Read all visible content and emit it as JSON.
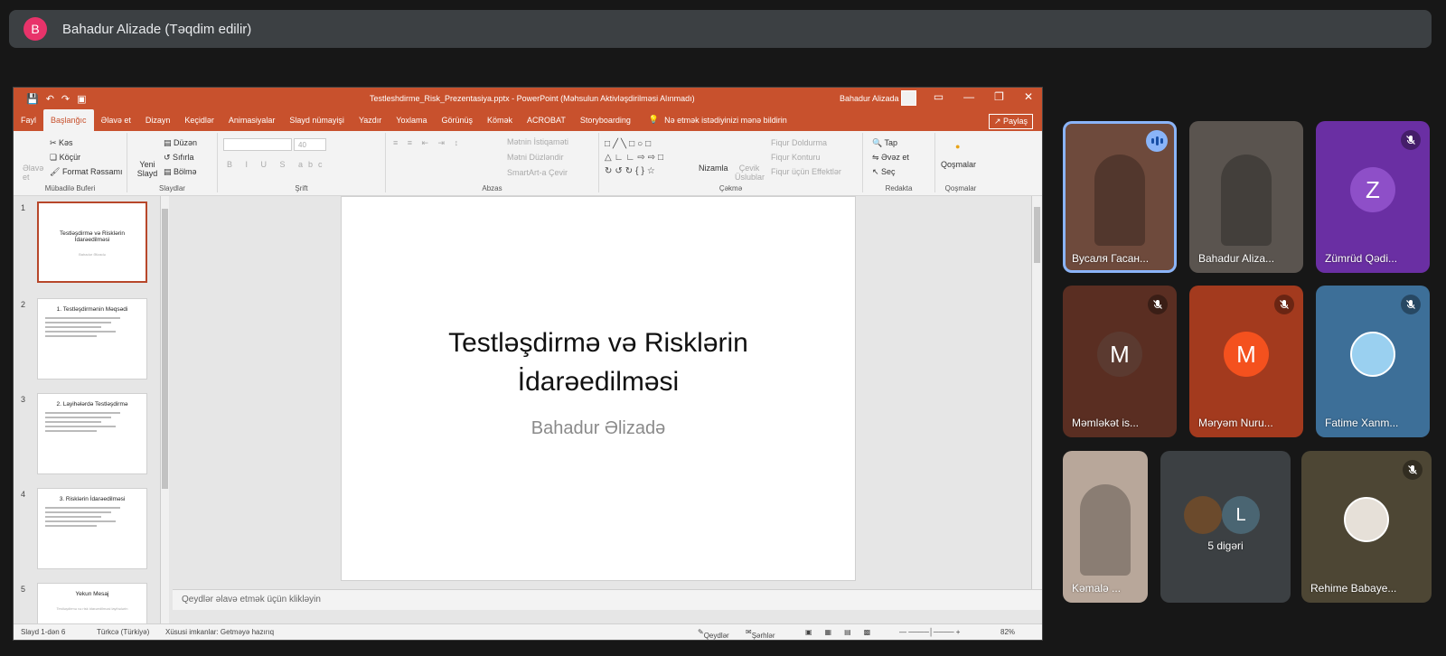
{
  "meet": {
    "presenter_initial": "B",
    "presenter_label": "Bahadur Alizade (Təqdim edilir)",
    "accent": "#e8336a"
  },
  "ppt": {
    "doc_title": "Testleshdirme_Risk_Prezentasiya.pptx  -  PowerPoint (Məhsulun Aktivləşdirilməsi Alınmadı)",
    "user": "Bahadur Alizada",
    "share": "Paylaş",
    "tabs": [
      "Fayl",
      "Başlanğıc",
      "Əlavə et",
      "Dizayn",
      "Keçidlər",
      "Animasiyalar",
      "Slayd nümayişi",
      "Yazdır",
      "Yoxlama",
      "Görünüş",
      "Kömək",
      "ACROBAT",
      "Storyboarding"
    ],
    "active_tab": "Başlanğıc",
    "tell_me": "Nə etmək istədiyinizi mənə bildirin",
    "ribbon": {
      "clipboard": {
        "paste": "Əlavə et",
        "cut": "Kəs",
        "copy": "Köçür",
        "format": "Format Rəssamı",
        "label": "Mübadilə Buferi"
      },
      "slides": {
        "new": "Yeni Slayd",
        "layout": "Düzən",
        "reset": "Sıfırla",
        "section": "Bölmə",
        "label": "Slaydlar"
      },
      "font": {
        "label": "Şrift",
        "size": "40"
      },
      "paragraph": {
        "direction": "Mətnin İstiqaməti",
        "align": "Mətni Düzləndir",
        "smartart": "SmartArt-a Çevir",
        "label": "Abzas"
      },
      "drawing": {
        "arrange": "Nizamla",
        "styles": "Çevik Üslublar",
        "fill": "Fiqur Doldurma",
        "outline": "Fiqur Konturu",
        "effects": "Fiqur üçün Effektlər",
        "label": "Çəkmə"
      },
      "editing": {
        "find": "Tap",
        "replace": "Əvəz et",
        "select": "Seç",
        "label": "Redakta"
      },
      "addins": {
        "addins": "Qoşmalar",
        "label": "Qoşmalar"
      }
    },
    "thumbnails": [
      {
        "num": "1",
        "title": "Testləşdirmə və Risklərin İdarəedilməsi",
        "sub": "Bahadur Əlizadə"
      },
      {
        "num": "2",
        "title": "1. Testləşdirmənin Məqsədi"
      },
      {
        "num": "3",
        "title": "2. Layihələrdə Testləşdirmə"
      },
      {
        "num": "4",
        "title": "3. Risklərin İdarəedilməsi"
      },
      {
        "num": "5",
        "title": "Yekun Mesaj",
        "sub": "Testləşdirmə və risk idarəedilməsi layihələrin"
      }
    ],
    "slide": {
      "title": "Testləşdirmə və Risklərin\nİdarəedilməsi",
      "subtitle": "Bahadur Əlizadə"
    },
    "notes_placeholder": "Qeydlər əlavə etmək üçün klikləyin",
    "status": {
      "slide": "Slayd 1-dən 6",
      "language": "Türkcə (Türkiyə)",
      "accessibility": "Xüsusi imkanlar: Getməyə hazırıq",
      "notes": "Qeydlər",
      "comments": "Şərhlər",
      "zoom": "82%"
    }
  },
  "participants": [
    {
      "name": "Вусаля Гасан...",
      "speaking": true,
      "bg": "#6e4a3c"
    },
    {
      "name": "Bahadur Aliza...",
      "bg": "#5a544f"
    },
    {
      "name": "Zümrüd Qədi...",
      "initial": "Z",
      "muted": true,
      "bg": "#6a2fa3",
      "ava_bg": "#8e4fc8"
    },
    {
      "name": "Məmləkət is...",
      "initial": "M",
      "muted": true,
      "bg": "#5a2e22",
      "ava_bg": "#5b3a30"
    },
    {
      "name": "Məryəm Nuru...",
      "initial": "M",
      "muted": true,
      "bg": "#a33a1e",
      "ava_bg": "#f4511e"
    },
    {
      "name": "Fatime Xanm...",
      "muted": true,
      "bg": "#3d6f98"
    },
    {
      "name": "Kəmalə ...",
      "bg": "#b8a79a"
    },
    {
      "name": "5 digəri",
      "initial": "L",
      "bg": "#3c4043",
      "ava_bg": "#4a6572"
    },
    {
      "name": "Rehime Babaye...",
      "muted": true,
      "bg": "#4d4634"
    }
  ]
}
